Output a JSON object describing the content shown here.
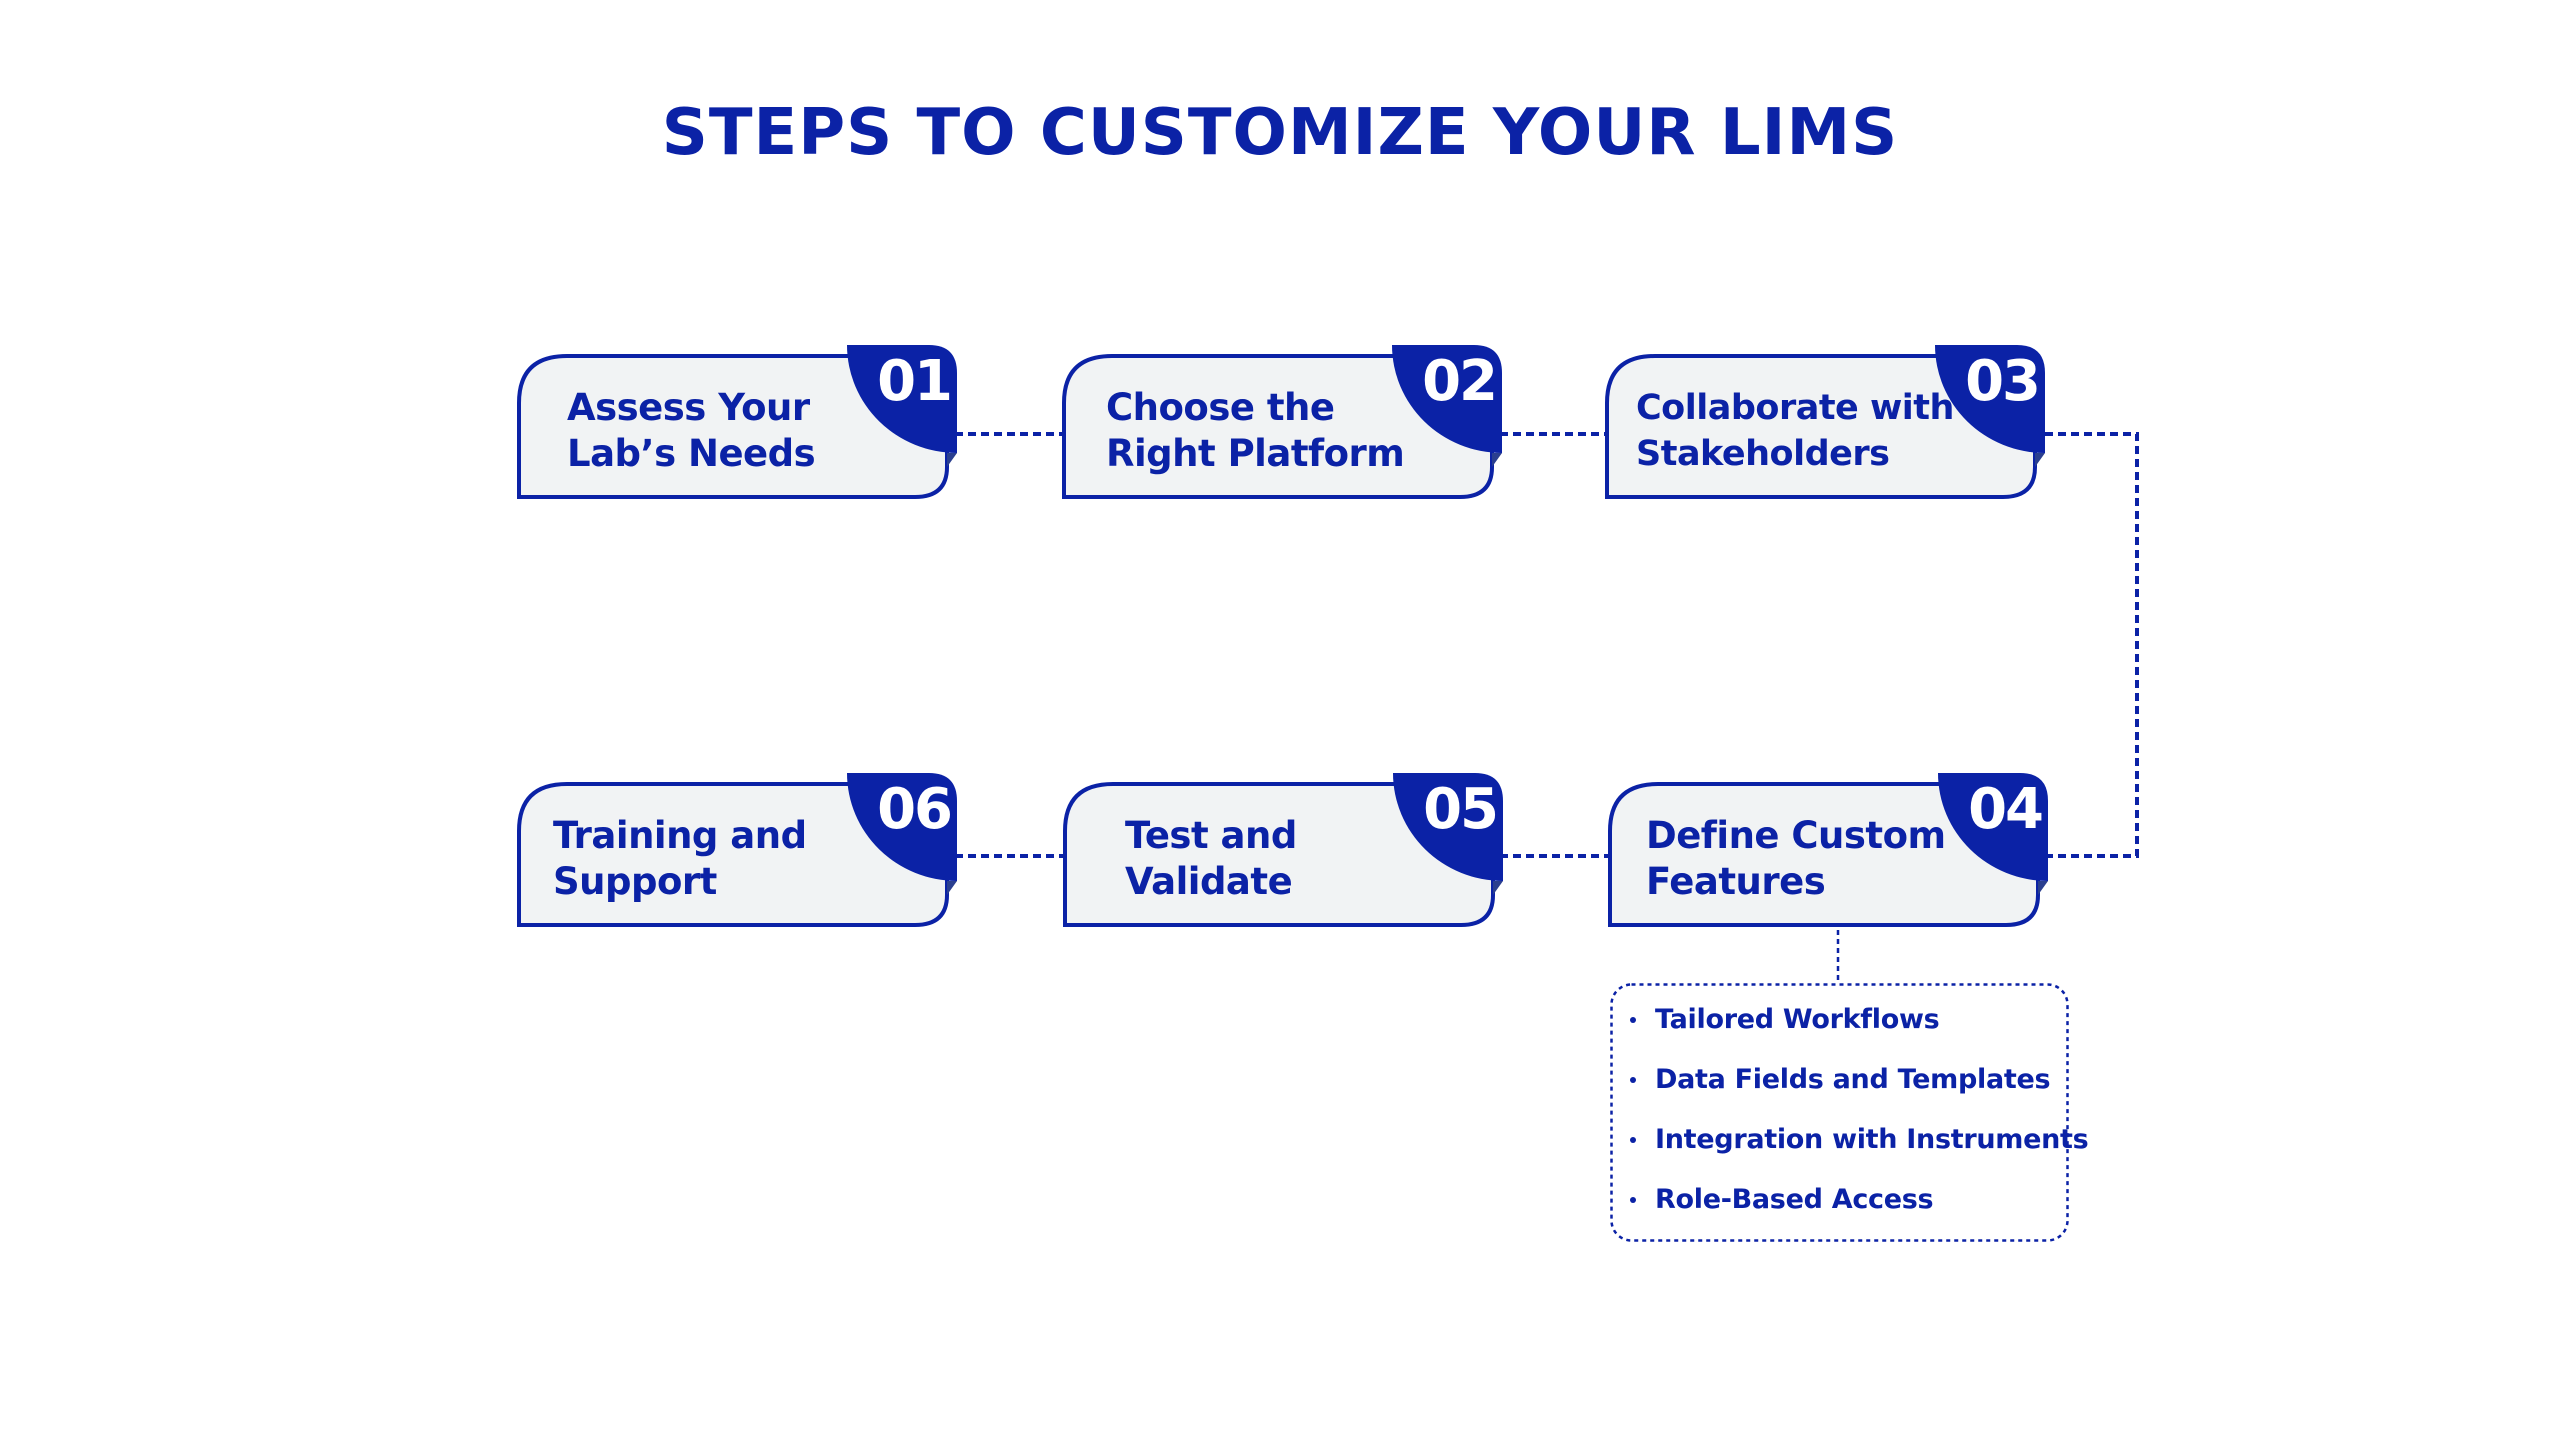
{
  "title": "STEPS TO CUSTOMIZE YOUR LIMS",
  "colors": {
    "primary": "#0B22A6",
    "box_fill": "#F1F3F4",
    "background": "#FFFFFF",
    "badge_text": "#FFFFFF"
  },
  "steps": [
    {
      "number": "01",
      "line1": "Assess Your",
      "line2": "Lab’s Needs"
    },
    {
      "number": "02",
      "line1": "Choose the",
      "line2": "Right Platform"
    },
    {
      "number": "03",
      "line1": "Collaborate with",
      "line2": "Stakeholders"
    },
    {
      "number": "04",
      "line1": "Define Custom",
      "line2": "Features"
    },
    {
      "number": "05",
      "line1": "Test and",
      "line2": "Validate"
    },
    {
      "number": "06",
      "line1": "Training and",
      "line2": "Support"
    }
  ],
  "step4_details": {
    "items": [
      "Tailored Workflows",
      "Data Fields and Templates",
      "Integration with Instruments",
      "Role-Based Access"
    ]
  }
}
